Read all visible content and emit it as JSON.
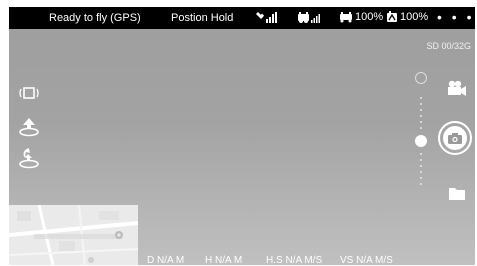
{
  "topbar": {
    "status": "Ready to fly (GPS)",
    "mode": "Postion Hold",
    "aircraft_battery": "100%",
    "remote_battery": "100%",
    "more": "• • •"
  },
  "storage": {
    "sd": "SD 00/32G"
  },
  "telemetry": {
    "d": "D N/A M",
    "h": "H N/A M",
    "hs": "H.S N/A M/S",
    "vs": "VS  N/A M/S"
  },
  "colors": {
    "topbar": "#000000",
    "text": "#ffffff"
  },
  "icons": [
    "gps-signal-icon",
    "rc-signal-icon",
    "aircraft-battery-icon",
    "remote-battery-icon",
    "more-icon",
    "gimbal-icon",
    "takeoff-icon",
    "return-home-icon",
    "video-mode-icon",
    "shutter-camera-icon",
    "gallery-folder-icon",
    "zoom-icon"
  ]
}
